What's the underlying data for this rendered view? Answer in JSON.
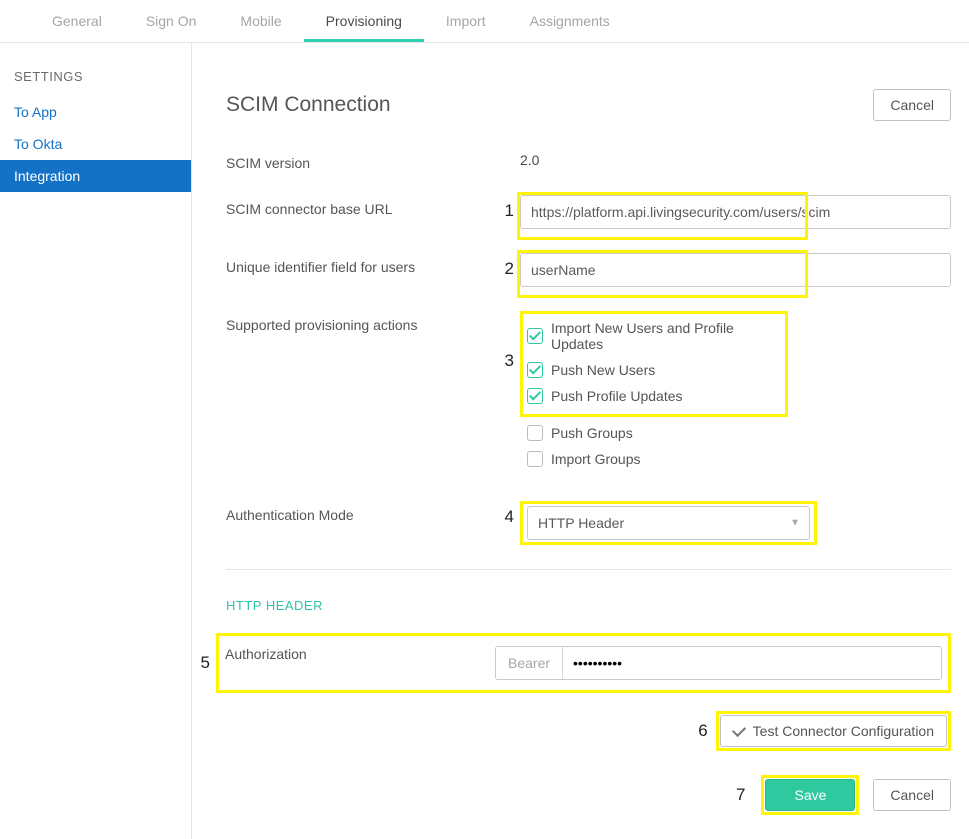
{
  "tabs": {
    "items": [
      {
        "label": "General"
      },
      {
        "label": "Sign On"
      },
      {
        "label": "Mobile"
      },
      {
        "label": "Provisioning"
      },
      {
        "label": "Import"
      },
      {
        "label": "Assignments"
      }
    ],
    "active": 3
  },
  "sidebar": {
    "heading": "SETTINGS",
    "items": [
      {
        "label": "To App"
      },
      {
        "label": "To Okta"
      },
      {
        "label": "Integration"
      }
    ],
    "active": 2
  },
  "section": {
    "title": "SCIM Connection",
    "cancel": "Cancel"
  },
  "form": {
    "version_label": "SCIM version",
    "version_value": "2.0",
    "base_url_label": "SCIM connector base URL",
    "base_url_value": "https://platform.api.livingsecurity.com/users/scim",
    "uid_label": "Unique identifier field for users",
    "uid_value": "userName",
    "actions_label": "Supported provisioning actions",
    "actions": [
      {
        "label": "Import New Users and Profile Updates",
        "checked": true
      },
      {
        "label": "Push New Users",
        "checked": true
      },
      {
        "label": "Push Profile Updates",
        "checked": true
      },
      {
        "label": "Push Groups",
        "checked": false
      },
      {
        "label": "Import Groups",
        "checked": false
      }
    ],
    "auth_mode_label": "Authentication Mode",
    "auth_mode_value": "HTTP Header"
  },
  "httpHeader": {
    "heading": "HTTP HEADER",
    "auth_label": "Authorization",
    "prefix": "Bearer",
    "token_masked": "••••••••••"
  },
  "annotations": {
    "n1": "1",
    "n2": "2",
    "n3": "3",
    "n4": "4",
    "n5": "5",
    "n6": "6",
    "n7": "7"
  },
  "buttons": {
    "test": "Test Connector Configuration",
    "save": "Save",
    "cancel": "Cancel"
  }
}
